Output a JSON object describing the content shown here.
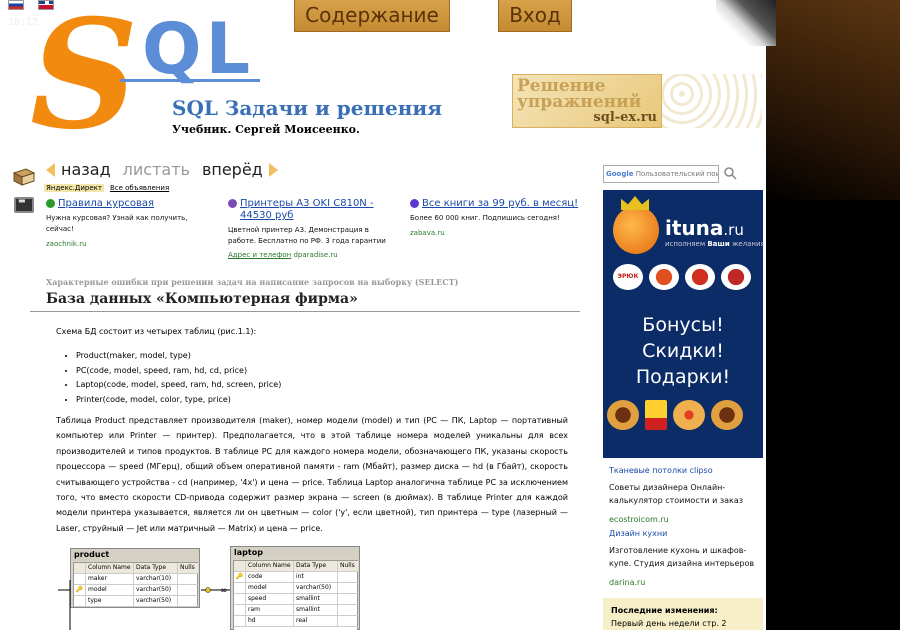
{
  "header": {
    "time": "18:12",
    "tab_contents": "Содержание",
    "tab_login": "Вход",
    "logo_s": "S",
    "logo_ql": "QL",
    "site_title": "SQL Задачи и решения",
    "site_subtitle": "Учебник. Сергей Моисеенко.",
    "exercises_banner": {
      "line1": "Решение",
      "line2": "упражнений",
      "url": "sql-ex.ru"
    }
  },
  "search": {
    "brand": "Google",
    "placeholder": "Пользовательский поиск"
  },
  "nav": {
    "back": "назад",
    "list": "листать",
    "forward": "вперёд"
  },
  "yandex_direct": {
    "label": "Яндекс.Директ",
    "all_ads": "Все объявления"
  },
  "ads": [
    {
      "title": "Правила курсовая",
      "text": "Нужна курсовая? Узнай как получить, сейчас!",
      "domain": "zaochnik.ru",
      "extra": "",
      "extra_domain": "",
      "icon_color": "#2a9a2a"
    },
    {
      "title": "Принтеры А3 OKI C810N - 44530 руб",
      "text": "Цветной принтер А3. Демонстрация в работе. Бесплатно по РФ. 3 года гарантии",
      "domain": "",
      "extra": "Адрес и телефон",
      "extra_domain": "dparadise.ru",
      "icon_color": "#7a4ab8"
    },
    {
      "title": "Все книги за 99 руб. в месяц!",
      "text": "Более 60 000 книг. Подпишись сегодня!",
      "domain": "zabava.ru",
      "extra": "",
      "extra_domain": "",
      "icon_color": "#5a3ad0"
    }
  ],
  "article": {
    "breadcrumb": "Характерные ошибки при решении задач на написание запросов на выборку (SELECT)",
    "title": "База данных «Компьютерная фирма»",
    "intro": "Схема БД состоит из четырех таблиц (рис.1.1):",
    "tables": [
      "Product(maker, model, type)",
      "PC(code, model, speed, ram, hd, cd, price)",
      "Laptop(code, model, speed, ram, hd, screen, price)",
      "Printer(code, model, color, type, price)"
    ],
    "paragraph": "Таблица Product представляет производителя (maker), номер модели (model) и тип (PC — ПК, Laptop — портативный компьютер или Printer — принтер). Предполагается, что в этой таблице номера моделей уникальны для всех производителей и типов продуктов. В таблице PC для каждого номера модели, обозначающего ПК, указаны скорость процессора — speed (МГерц), общий объем оперативной памяти - ram (Мбайт), размер диска — hd (в Гбайт), скорость считывающего устройства - cd (например, '4x') и цена — price. Таблица Laptop аналогична таблице РС за исключением того, что вместо скорости CD-привода содержит размер экрана — screen (в дюймах). В таблице Printer для каждой модели принтера указывается, является ли он цветным — color ('y', если цветной), тип принтера — type (лазерный — Laser, струйный — Jet или матричный — Matrix) и цена — price."
  },
  "diagram": {
    "columns": [
      "Column Name",
      "Data Type",
      "Nulls"
    ],
    "product": {
      "name": "product",
      "rows": [
        {
          "key": "",
          "col": "maker",
          "type": "varchar(10)",
          "nulls": ""
        },
        {
          "key": "🔑",
          "col": "model",
          "type": "varchar(50)",
          "nulls": ""
        },
        {
          "key": "",
          "col": "type",
          "type": "varchar(50)",
          "nulls": ""
        }
      ]
    },
    "laptop": {
      "name": "laptop",
      "rows": [
        {
          "key": "🔑",
          "col": "code",
          "type": "int",
          "nulls": ""
        },
        {
          "key": "",
          "col": "model",
          "type": "varchar(50)",
          "nulls": ""
        },
        {
          "key": "",
          "col": "speed",
          "type": "smallint",
          "nulls": ""
        },
        {
          "key": "",
          "col": "ram",
          "type": "smallint",
          "nulls": ""
        },
        {
          "key": "",
          "col": "hd",
          "type": "real",
          "nulls": ""
        }
      ]
    }
  },
  "sidebar": {
    "banner": {
      "brand": "ituna",
      "brand_suffix": ".ru",
      "tagline_pre": "исполняем",
      "tagline_bold": "Ваши",
      "tagline_post": "желания",
      "line1": "Бонусы!",
      "line2": "Скидки!",
      "line3": "Подарки!",
      "logo_text": "ЭРЮК"
    },
    "ads": [
      {
        "link": "Тканевые потолки clipso",
        "text": "Советы дизайнера Онлайн-калькулятор стоимости и заказ",
        "domain": "ecostroicom.ru"
      },
      {
        "link": "Дизайн кухни",
        "text": "Изготовление кухонь и шкафов-купе. Студия дизайна интерьеров",
        "domain": "darina.ru"
      }
    ],
    "changes_title": "Последние изменения:",
    "changes_item": "Первый день недели стр. 2"
  }
}
